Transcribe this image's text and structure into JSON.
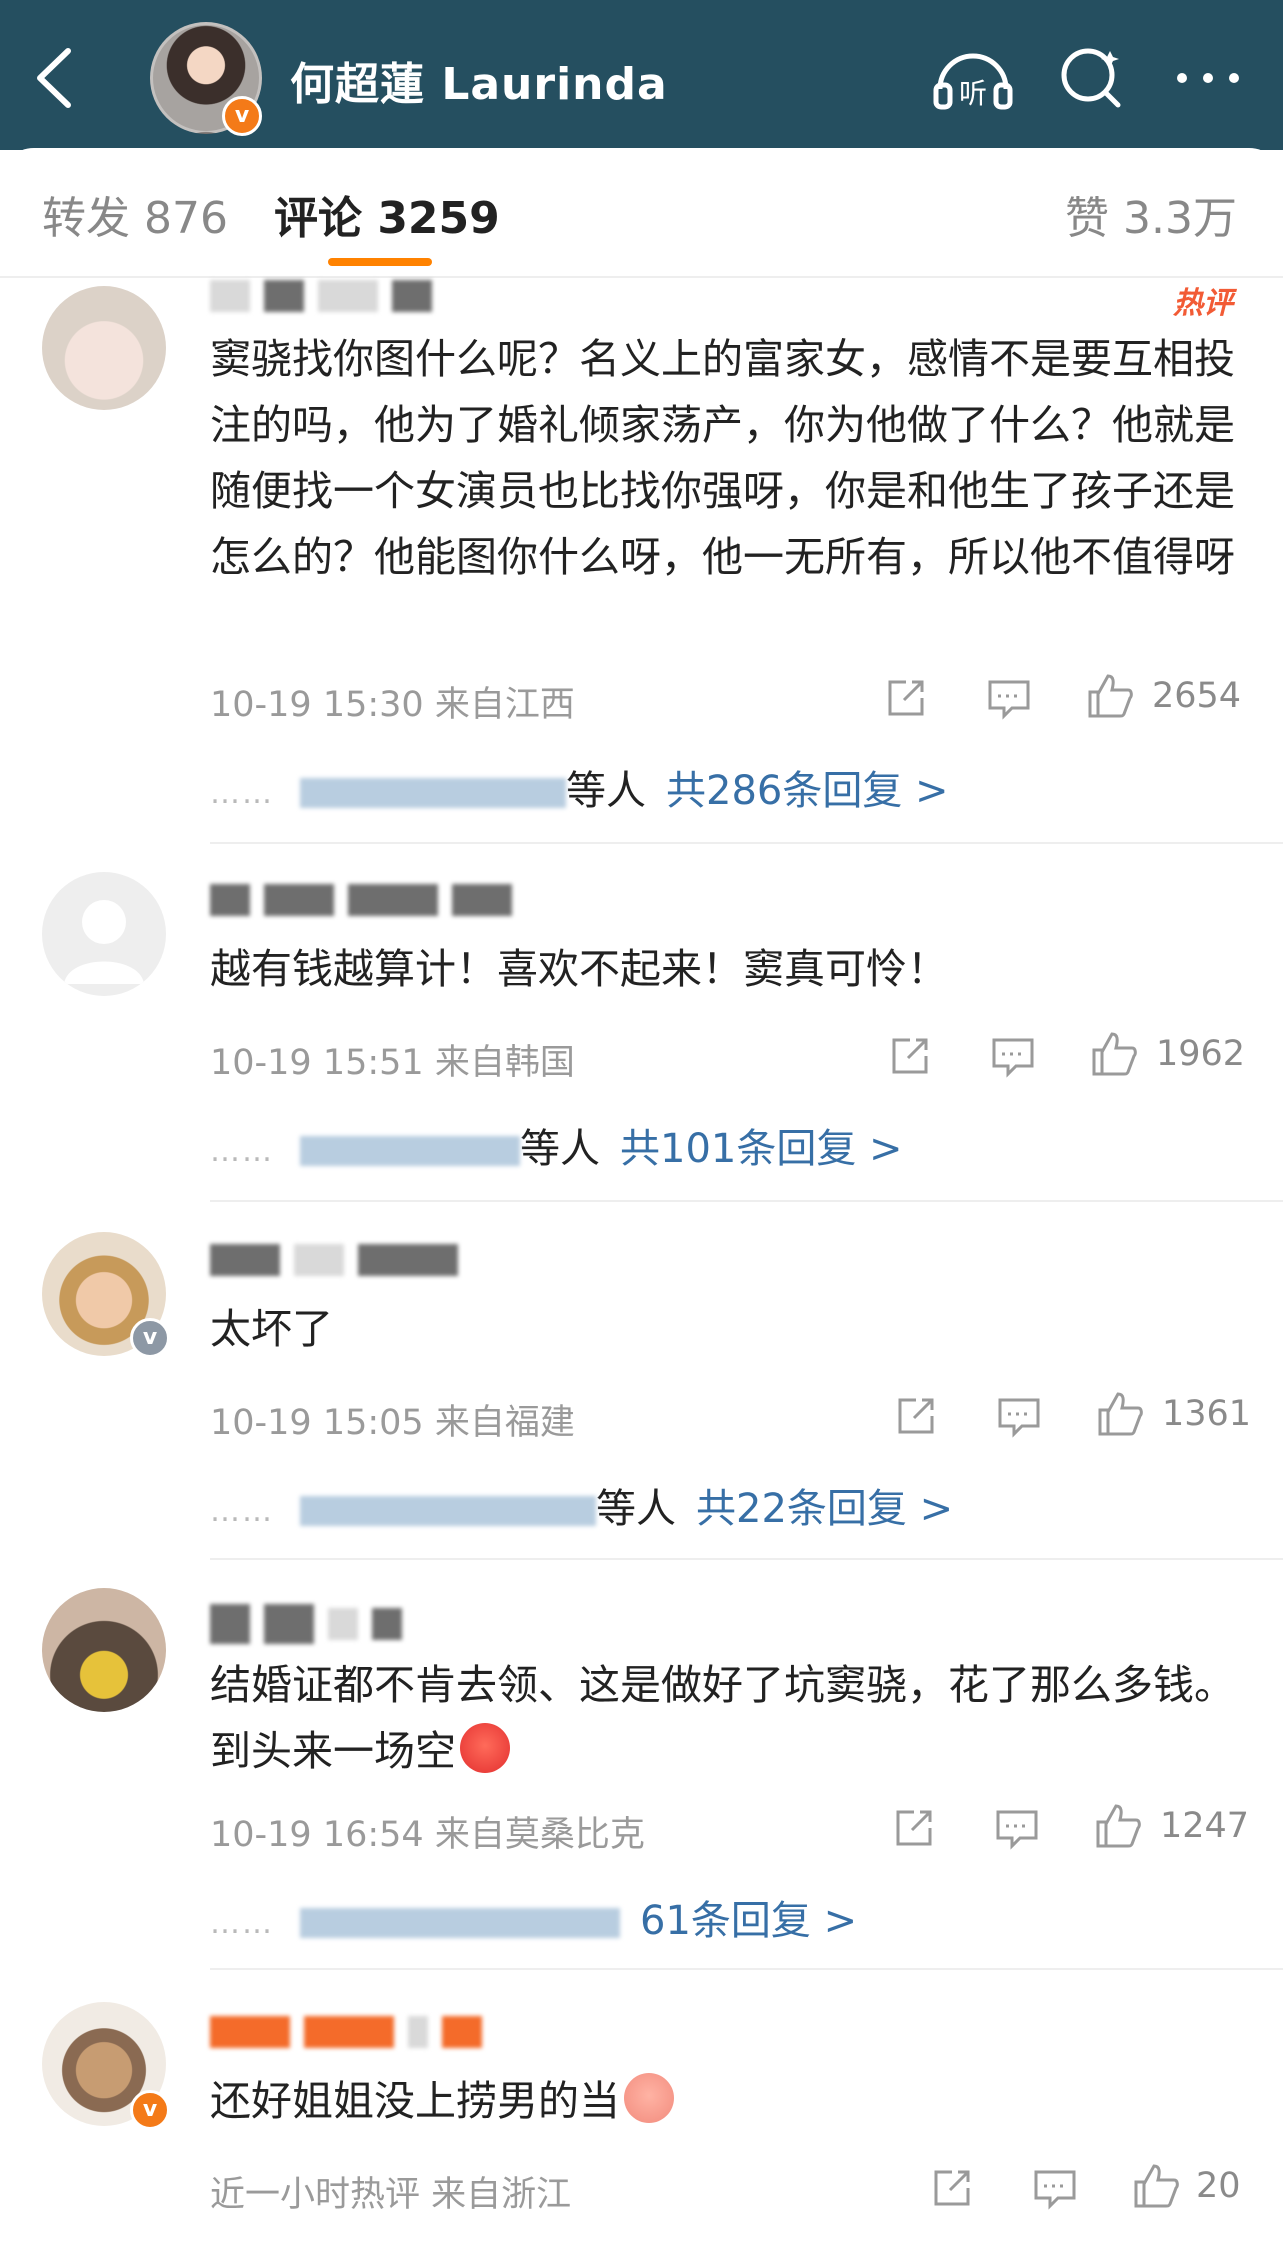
{
  "header": {
    "title": "何超蓮 Laurinda",
    "verified_badge": "v",
    "icons": [
      "back-arrow-icon",
      "listen-icon",
      "search-icon",
      "more-icon"
    ],
    "listen_label": "听"
  },
  "tabs": {
    "repost": "转发 876",
    "comment": "评论 3259",
    "like": "赞 3.3万"
  },
  "colors": {
    "topbar": "#254f60",
    "accent": "#ff8200",
    "link": "#376fa6",
    "hot": "#f25b35"
  },
  "comments": [
    {
      "hot": "热评",
      "text": "窦骁找你图什么呢？名义上的富家女，感情不是要互相投注的吗，他为了婚礼倾家荡产，你为他做了什么？他就是随便找一个女演员也比找你强呀，你是和他生了孩子还是怎么的？他能图你什么呀，他一无所有，所以他不值得呀",
      "meta": "10-19 15:30  来自江西",
      "likes": "2654",
      "reply_etc": "等人",
      "reply_link": "共286条回复 >"
    },
    {
      "text": "越有钱越算计！喜欢不起来！窦真可怜！",
      "meta": "10-19 15:51  来自韩国",
      "likes": "1962",
      "reply_etc": "等人",
      "reply_link": "共101条回复 >"
    },
    {
      "text": "太坏了",
      "meta": "10-19 15:05  来自福建",
      "likes": "1361",
      "reply_etc": "等人",
      "reply_link": "共22条回复 >"
    },
    {
      "text": "结婚证都不肯去领、这是做好了坑窦骁，花了那么多钱。到头来一场空",
      "meta": "10-19 16:54  来自莫桑比克",
      "likes": "1247",
      "reply_etc": "",
      "reply_link": "61条回复 >"
    },
    {
      "text": "还好姐姐没上捞男的当",
      "meta": "近一小时热评  来自浙江",
      "likes": "20"
    }
  ],
  "reply_dots": "……"
}
